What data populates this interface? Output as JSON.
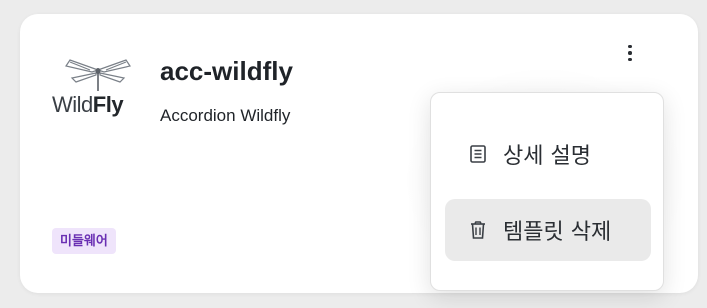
{
  "card": {
    "logo": {
      "brand_light": "Wild",
      "brand_bold": "Fly",
      "icon": "dragonfly-logo"
    },
    "title": "acc-wildfly",
    "subtitle": "Accordion Wildfly",
    "tag": "미들웨어"
  },
  "menu": {
    "items": [
      {
        "label": "상세 설명",
        "icon": "document-icon"
      },
      {
        "label": "템플릿 삭제",
        "icon": "trash-icon"
      }
    ]
  },
  "colors": {
    "tag_bg": "#efe4fb",
    "tag_text": "#6a2fb3",
    "hover_bg": "#eaeaea"
  }
}
